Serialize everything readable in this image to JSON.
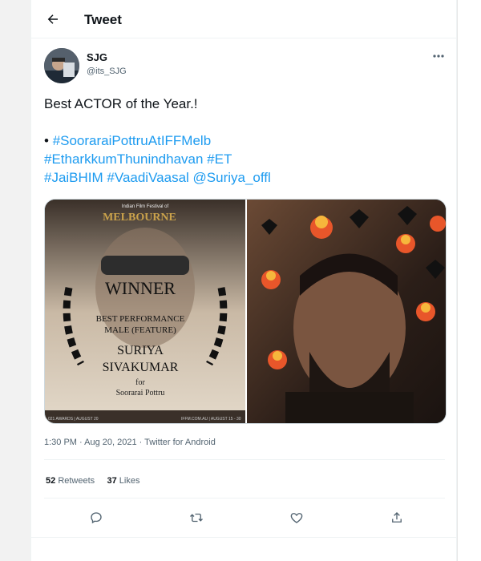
{
  "header": {
    "title": "Tweet",
    "back_icon": "arrow-left-icon"
  },
  "tweet": {
    "author_name": "SJG",
    "author_handle": "@its_SJG",
    "text_line1": "Best ACTOR of the Year.!",
    "bullet": "•",
    "hashtags_line1": "#SooraraiPottruAtIFFMelb",
    "hashtags_line2": "#EtharkkumThunindhavan #ET",
    "hashtags_line3": "#JaiBHIM #VaadiVaasal @Suriya_offl",
    "timestamp": "1:30 PM · Aug 20, 2021 · Twitter for Android",
    "retweets_count": "52",
    "retweets_label": "Retweets",
    "likes_count": "37",
    "likes_label": "Likes"
  },
  "media": {
    "poster": {
      "festival_small": "Indian Film Festival of",
      "festival_city": "MELBOURNE",
      "winner": "WINNER",
      "category1": "BEST PERFORMANCE",
      "category2": "MALE (FEATURE)",
      "actor1": "SURIYA",
      "actor2": "SIVAKUMAR",
      "for_text": "for",
      "film": "Soorarai Pottru",
      "footer_left": "021 AWARDS | AUGUST 20",
      "footer_right": "IFFM.COM.AU | AUGUST 15 - 30"
    }
  },
  "actions": [
    "reply-icon",
    "retweet-icon",
    "like-icon",
    "share-icon"
  ],
  "colors": {
    "link": "#1d9bf0",
    "secondary_text": "#536471",
    "divider": "#eff3f4"
  }
}
